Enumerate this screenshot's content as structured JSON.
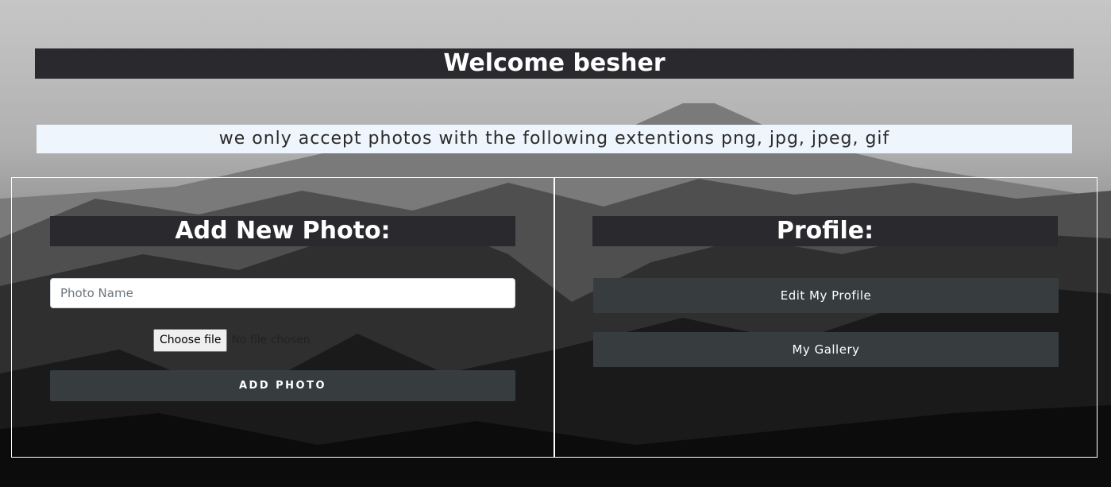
{
  "header": {
    "welcome": "Welcome besher",
    "notice": "we only accept photos with the following extentions png, jpg, jpeg, gif"
  },
  "add_photo_panel": {
    "title": "Add New Photo:",
    "photo_name_placeholder": "Photo Name",
    "photo_name_value": "",
    "choose_file_label": "Choose file",
    "file_status": "No file chosen",
    "submit_label": "ADD PHOTO"
  },
  "profile_panel": {
    "title": "Profile:",
    "edit_profile_label": "Edit My Profile",
    "gallery_label": "My Gallery"
  },
  "colors": {
    "title_bar": "#29292e",
    "notice_bg": "#eef5fc",
    "button_bg": "#373d3f",
    "panel_border": "#ffffff"
  }
}
